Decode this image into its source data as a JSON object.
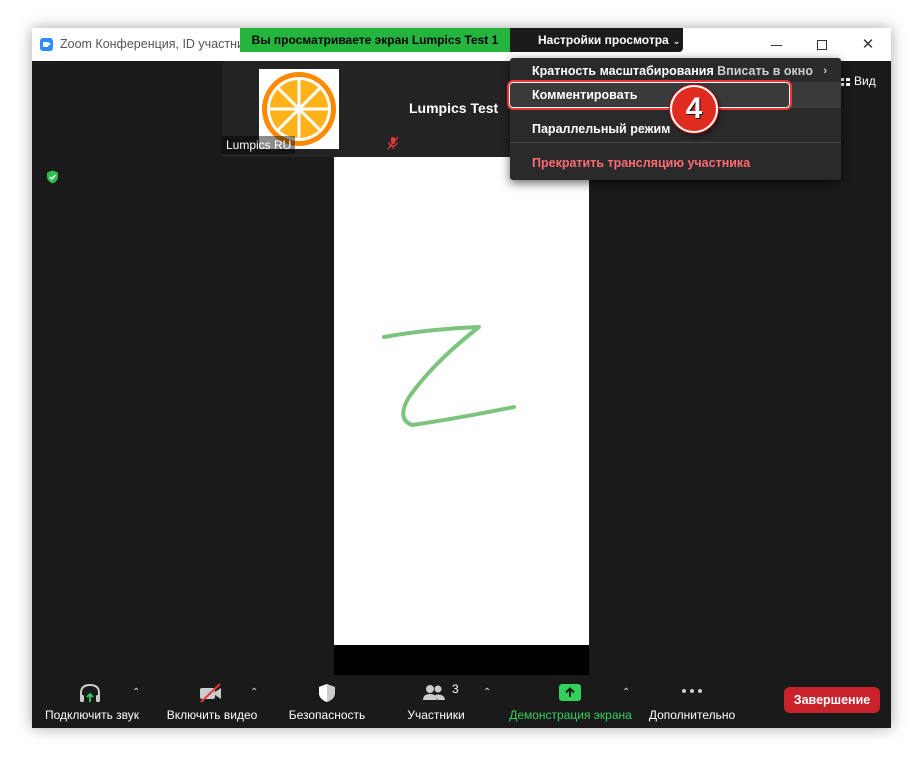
{
  "window": {
    "title": "Zoom Конференция, ID участник",
    "share_banner": "Вы просматриваете экран Lumpics Test 1",
    "view_options": "Настройки просмотра"
  },
  "participants": {
    "thumb_name": "Lumpics RU",
    "speaker_name": "Lumpics Test"
  },
  "view_button": "Вид",
  "menu": {
    "zoom_label": "Кратность масштабирования",
    "zoom_value": "Вписать в окно",
    "annotate": "Комментировать",
    "parallel": "Параллельный режим",
    "stop": "Прекратить трансляцию участника"
  },
  "step_number": "4",
  "toolbar": {
    "audio": "Подключить звук",
    "video": "Включить видео",
    "security": "Безопасность",
    "participants": "Участники",
    "participants_count": "3",
    "share": "Демонстрация экрана",
    "more": "Дополнительно",
    "end": "Завершение"
  },
  "colors": {
    "banner_green": "#25b53f",
    "share_green": "#33d15c",
    "end_red": "#c8232a",
    "stop_text": "#ff6a73",
    "drawing_stroke": "#7cc47e"
  }
}
